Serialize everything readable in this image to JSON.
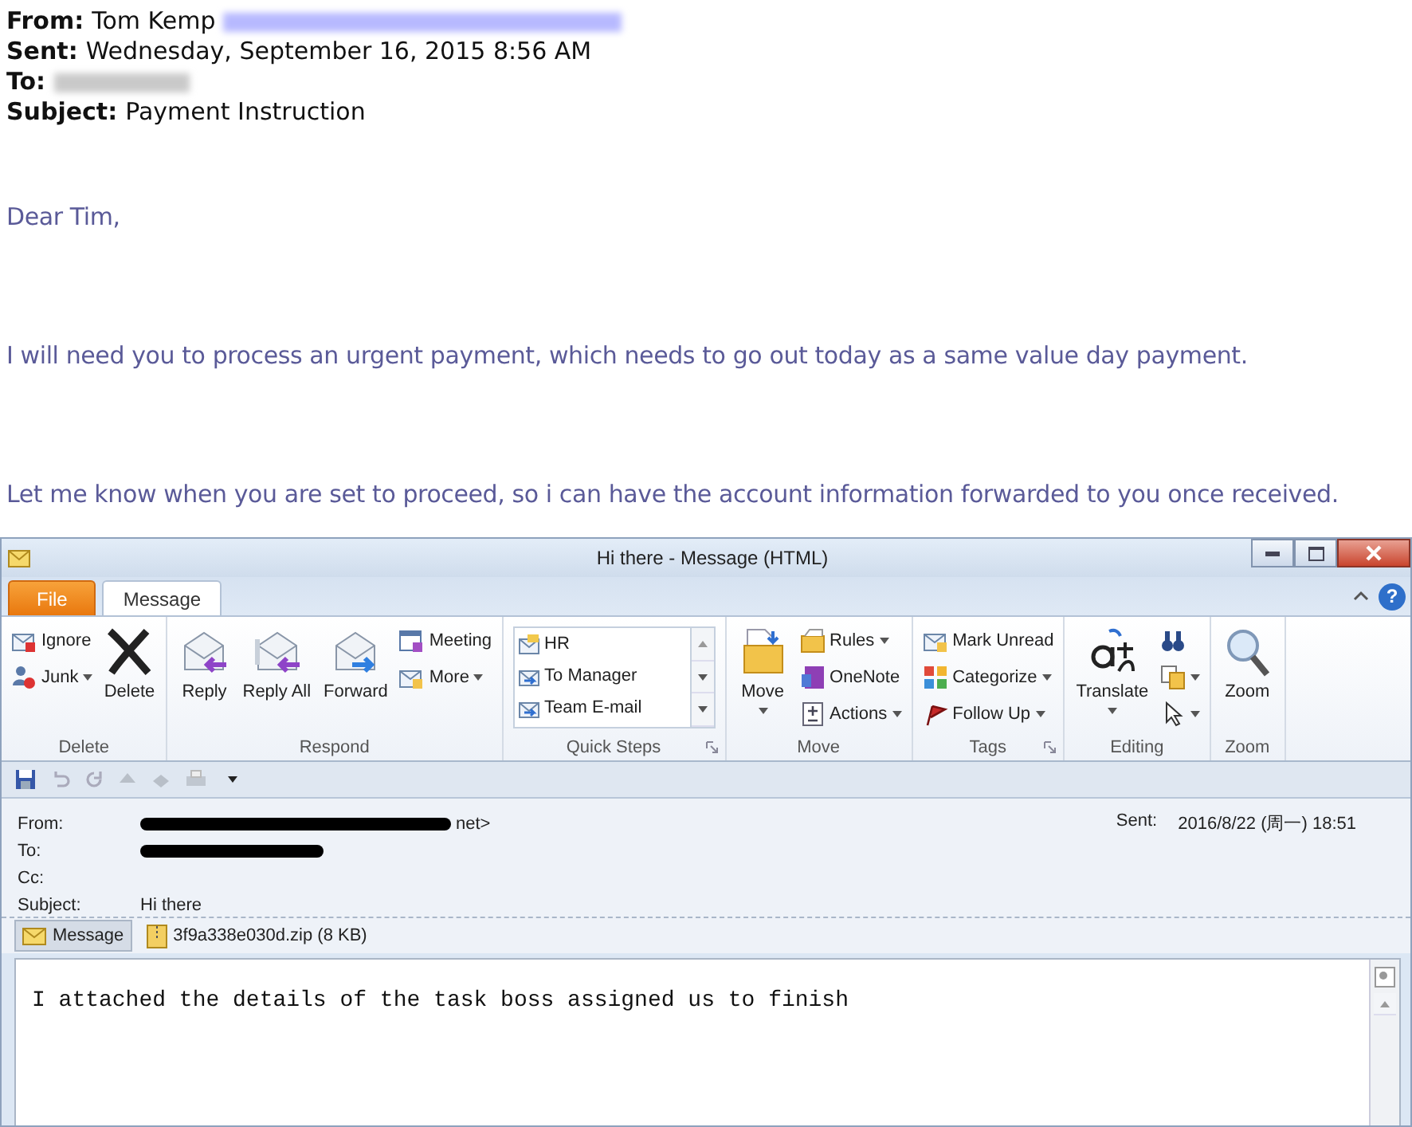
{
  "printed_email": {
    "header": [
      {
        "label": "From:",
        "value": "Tom Kemp",
        "redacted": true
      },
      {
        "label": "Sent:",
        "value": "Wednesday, September 16, 2015 8:56 AM"
      },
      {
        "label": "To:",
        "redacted": true
      },
      {
        "label": "Subject:",
        "value": "Payment Instruction"
      }
    ],
    "body": [
      "Dear Tim,",
      "I will need you to process an urgent payment, which needs to go out today as a same value day payment.",
      "Let me know when you are set to proceed, so i can have the account information forwarded to you once received."
    ]
  },
  "outlook_window": {
    "title": "Hi there  -  Message (HTML)",
    "tabs": [
      {
        "label": "File",
        "kind": "file",
        "selected": false
      },
      {
        "label": "Message",
        "kind": "tab",
        "selected": true
      }
    ],
    "help": "?",
    "ribbon_groups": [
      {
        "label": "Delete",
        "kind": "buttons",
        "columns": [
          [
            {
              "label": "Ignore",
              "kind": "small"
            },
            {
              "label": "Junk",
              "kind": "small",
              "dropdown": true
            }
          ],
          [
            {
              "label": "Delete",
              "kind": "large"
            }
          ]
        ]
      },
      {
        "label": "Respond",
        "kind": "buttons",
        "columns": [
          [
            {
              "label": "Reply",
              "kind": "large"
            }
          ],
          [
            {
              "label": "Reply All",
              "kind": "large"
            }
          ],
          [
            {
              "label": "Forward",
              "kind": "large"
            }
          ],
          [
            {
              "label": "Meeting",
              "kind": "small"
            },
            {
              "label": "More",
              "kind": "small",
              "dropdown": true
            }
          ]
        ]
      },
      {
        "label": "Quick Steps",
        "kind": "gallery",
        "launcher": true,
        "items": [
          "HR",
          "To Manager",
          "Team E-mail"
        ]
      },
      {
        "label": "Move",
        "kind": "buttons",
        "columns": [
          [
            {
              "label": "Move",
              "kind": "large",
              "dropdown": true
            }
          ],
          [
            {
              "label": "Rules",
              "kind": "small",
              "dropdown": true
            },
            {
              "label": "OneNote",
              "kind": "small"
            },
            {
              "label": "Actions",
              "kind": "small",
              "dropdown": true
            }
          ]
        ]
      },
      {
        "label": "Tags",
        "kind": "buttons",
        "launcher": true,
        "columns": [
          [
            {
              "label": "Mark Unread",
              "kind": "small"
            },
            {
              "label": "Categorize",
              "kind": "small",
              "dropdown": true
            },
            {
              "label": "Follow Up",
              "kind": "small",
              "dropdown": true
            }
          ]
        ]
      },
      {
        "label": "Editing",
        "kind": "buttons",
        "columns": [
          [
            {
              "label": "Translate",
              "kind": "large",
              "dropdown": true
            }
          ],
          [
            {
              "kind": "small"
            },
            {
              "kind": "small",
              "dropdown": true
            },
            {
              "kind": "small",
              "dropdown": true
            }
          ]
        ]
      },
      {
        "label": "Zoom",
        "kind": "buttons",
        "columns": [
          [
            {
              "label": "Zoom",
              "kind": "large"
            }
          ]
        ]
      }
    ],
    "message_header": {
      "fields": [
        {
          "label": "From:",
          "value": "net>",
          "redacted": true
        },
        {
          "label": "To:",
          "redacted": true
        },
        {
          "label": "Cc:"
        },
        {
          "label": "Subject:",
          "value": "Hi there"
        }
      ],
      "sent": {
        "label": "Sent:",
        "value": "2016/8/22 (周一) 18:51"
      }
    },
    "attachments": [
      {
        "label": "Message",
        "kind": "message",
        "selected": true
      },
      {
        "label": "3f9a338e030d.zip (8 KB)",
        "kind": "zip",
        "selected": false
      }
    ],
    "body": "I attached the details of the task boss assigned us to finish"
  }
}
